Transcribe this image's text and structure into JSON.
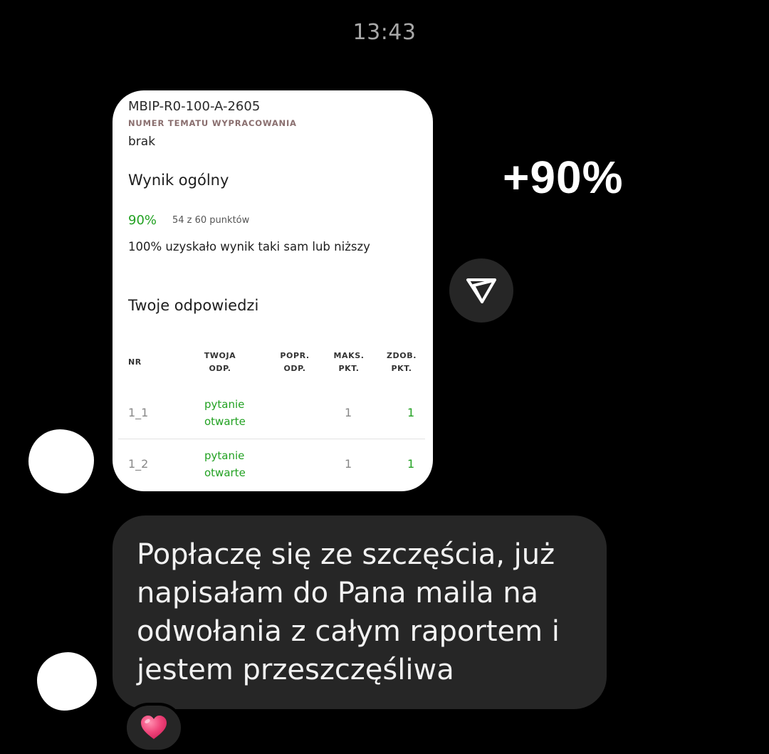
{
  "chat": {
    "timestamp": "13:43"
  },
  "report_card": {
    "topic_id": "MBIP-R0-100-A-2605",
    "topic_label": "NUMER TEMATU WYPRACOWANIA",
    "topic_value": "brak",
    "score_title": "Wynik ogólny",
    "score_percent": "90%",
    "score_points": "54 z 60 punktów",
    "percentile_text": "100% uzyskało wynik taki sam lub niższy",
    "answers_title": "Twoje odpowiedzi",
    "table": {
      "headers": {
        "nr": "NR",
        "twoja_1": "TWOJA",
        "twoja_2": "ODP.",
        "popr_1": "POPR.",
        "popr_2": "ODP.",
        "maks_1": "MAKS.",
        "maks_2": "PKT.",
        "zdob_1": "ZDOB.",
        "zdob_2": "PKT."
      },
      "rows": [
        {
          "nr": "1_1",
          "answer_1": "pytanie",
          "answer_2": "otwarte",
          "max": "1",
          "got": "1"
        },
        {
          "nr": "1_2",
          "answer_1": "pytanie",
          "answer_2": "otwarte",
          "max": "1",
          "got": "1"
        }
      ]
    }
  },
  "overlay": {
    "text": "+90%"
  },
  "message": {
    "line_1": "Popłaczę się ze szczęścia, już",
    "line_2": "napisałam do Pana maila na",
    "line_3": "odwołania z całym raportem i",
    "line_4": "jestem przeszczęśliwa"
  },
  "icons": {
    "share": "send-icon",
    "reaction": "heart-icon"
  },
  "colors": {
    "background": "#000000",
    "bubble": "#262626",
    "accent_green": "#22a122",
    "heart": "#f0457a"
  }
}
